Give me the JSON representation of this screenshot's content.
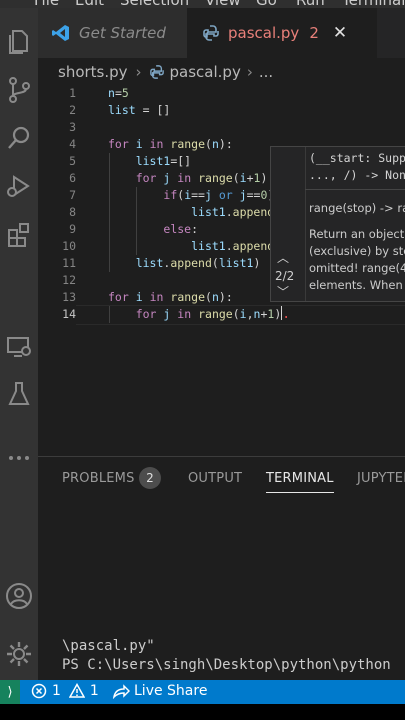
{
  "menu": {
    "items": [
      "File",
      "Edit",
      "Selection",
      "View",
      "Go",
      "Run",
      "Terminal"
    ]
  },
  "tabs": [
    {
      "label": "Get Started"
    },
    {
      "label": "pascal.py",
      "badge": "2"
    }
  ],
  "breadcrumb": {
    "folder": "shorts.py",
    "file": "pascal.py",
    "more": "..."
  },
  "editor": {
    "line_numbers": [
      "1",
      "2",
      "3",
      "4",
      "5",
      "6",
      "7",
      "8",
      "9",
      "10",
      "11",
      "12",
      "13",
      "14"
    ],
    "current_line": "14"
  },
  "hover": {
    "signature_1": "(__start: Suppo",
    "signature_2": "..., /) -> None",
    "overload_label": "range(stop) -> ran",
    "counter": "2/2",
    "doc_1": "Return an object th",
    "doc_2": "(exclusive) by step",
    "doc_3": "omitted! range(4)",
    "doc_4": "elements. When st"
  },
  "panel": {
    "tabs": [
      {
        "label": "PROBLEMS",
        "badge": "2"
      },
      {
        "label": "OUTPUT"
      },
      {
        "label": "TERMINAL"
      },
      {
        "label": "JUPYTER"
      }
    ],
    "terminal_lines": [
      "\\pascal.py\"",
      "PS C:\\Users\\singh\\Desktop\\python\\python"
    ]
  },
  "statusbar": {
    "errors": "1",
    "warnings": "1",
    "live_share": "Live Share"
  },
  "colors": {
    "accent": "#007acc",
    "editor_bg": "#1e1e1e",
    "activity_bar": "#333333"
  }
}
